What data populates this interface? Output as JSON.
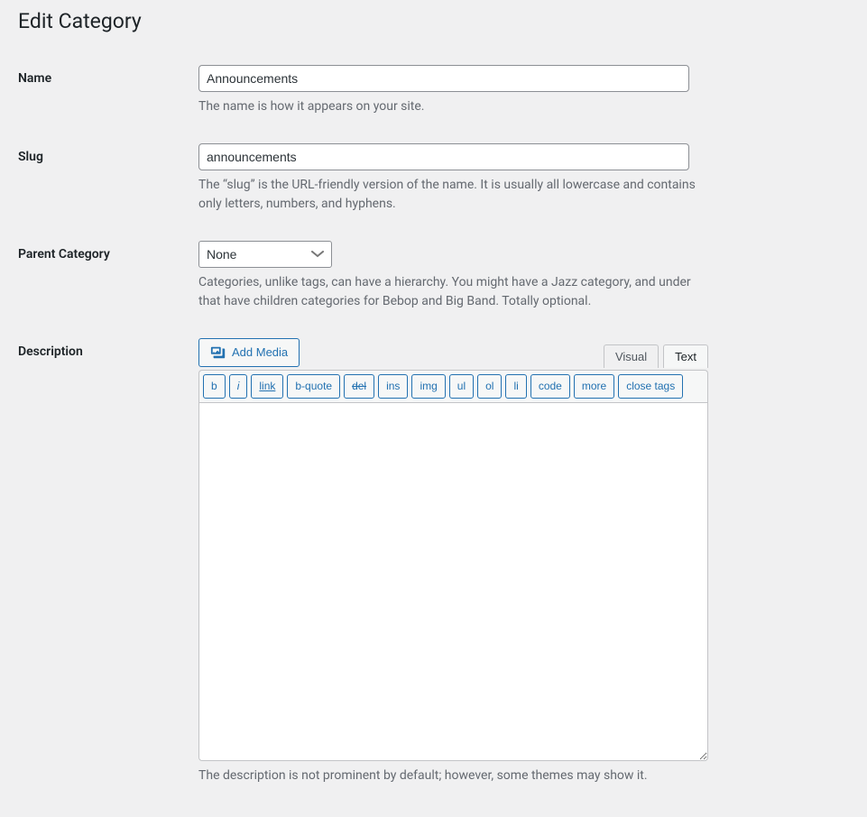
{
  "page": {
    "title": "Edit Category"
  },
  "fields": {
    "name": {
      "label": "Name",
      "value": "Announcements",
      "help": "The name is how it appears on your site."
    },
    "slug": {
      "label": "Slug",
      "value": "announcements",
      "help": "The “slug” is the URL-friendly version of the name. It is usually all lowercase and contains only letters, numbers, and hyphens."
    },
    "parent": {
      "label": "Parent Category",
      "selected": "None",
      "help": "Categories, unlike tags, can have a hierarchy. You might have a Jazz category, and under that have children categories for Bebop and Big Band. Totally optional."
    },
    "description": {
      "label": "Description",
      "value": "",
      "help": "The description is not prominent by default; however, some themes may show it."
    }
  },
  "editor": {
    "add_media_label": "Add Media",
    "tabs": {
      "visual": "Visual",
      "text": "Text",
      "active": "text"
    },
    "quicktags": {
      "b": "b",
      "i": "i",
      "link": "link",
      "bquote": "b-quote",
      "del": "del",
      "ins": "ins",
      "img": "img",
      "ul": "ul",
      "ol": "ol",
      "li": "li",
      "code": "code",
      "more": "more",
      "close": "close tags"
    }
  }
}
